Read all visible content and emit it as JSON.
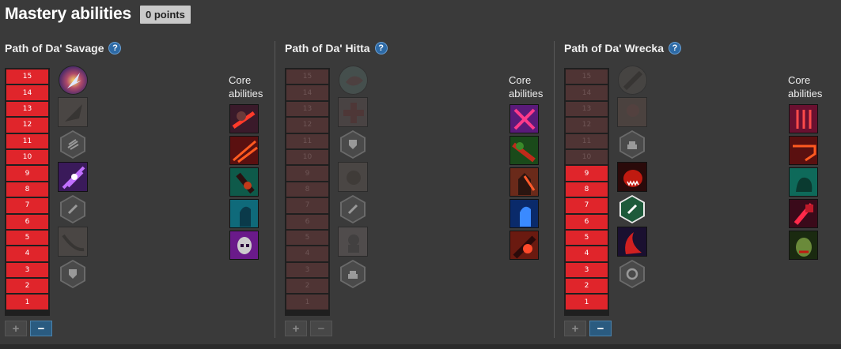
{
  "header": {
    "title": "Mastery abilities",
    "points": "0 points"
  },
  "levels": [
    "15",
    "14",
    "13",
    "12",
    "11",
    "10",
    "9",
    "8",
    "7",
    "6",
    "5",
    "4",
    "3",
    "2",
    "1"
  ],
  "core_label": "Core abilities",
  "controls": {
    "plus": "+",
    "minus": "−"
  },
  "trees": [
    {
      "name": "Path of Da' Savage",
      "help": "?",
      "unlocked_up_to": 15
    },
    {
      "name": "Path of Da' Hitta",
      "help": "?",
      "unlocked_up_to": 0
    },
    {
      "name": "Path of Da' Wrecka",
      "help": "?",
      "unlocked_up_to": 9
    }
  ],
  "colors": {
    "level_on": "#e0252b",
    "level_off": "#4f3434",
    "help": "#2d6aa6",
    "minus_active": "#2a5b80"
  }
}
